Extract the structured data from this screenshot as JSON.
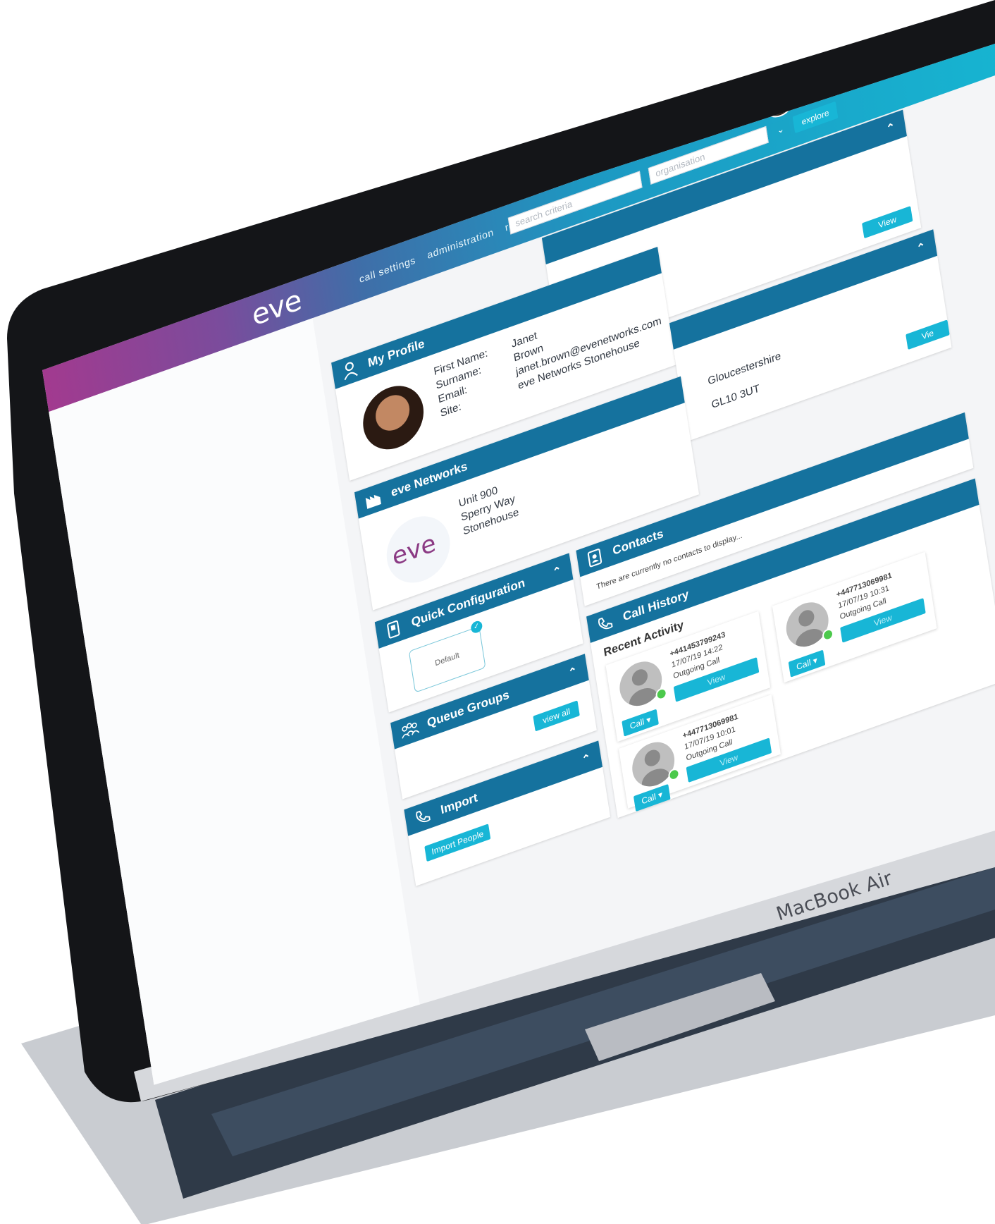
{
  "app": {
    "logo": "eve",
    "nav": [
      "call settings",
      "administration",
      "reporting"
    ],
    "search_placeholder": "search criteria",
    "org_placeholder": "organisation",
    "explore_label": "explore"
  },
  "top_panel": {
    "view_label": "View"
  },
  "profile": {
    "title": "My Profile",
    "fields": [
      {
        "label": "First Name:",
        "value": "Janet"
      },
      {
        "label": "Surname:",
        "value": "Brown"
      },
      {
        "label": "Email:",
        "value": "janet.brown@evenetworks.com"
      },
      {
        "label": "Site:",
        "value": "eve Networks Stonehouse"
      }
    ]
  },
  "right_panel": {
    "county": "Gloucestershire",
    "postcode": "GL10 3UT",
    "view_label": "Vie"
  },
  "site": {
    "title": "eve Networks",
    "address": [
      "Unit 900",
      "Sperry Way",
      "Stonehouse"
    ],
    "logo": "eve"
  },
  "quick_config": {
    "title": "Quick Configuration",
    "default_label": "Default"
  },
  "queue_groups": {
    "title": "Queue Groups",
    "view_all_label": "view all"
  },
  "import": {
    "title": "Import",
    "button_label": "Import People"
  },
  "contacts": {
    "title": "Contacts",
    "empty_text": "There are currently no contacts to display..."
  },
  "call_history": {
    "title": "Call History",
    "subtitle": "Recent Activity",
    "calls": [
      {
        "number": "+441453799243",
        "time": "17/07/19 14:22",
        "type": "Outgoing Call",
        "view": "View",
        "call": "Call ▾"
      },
      {
        "number": "+447713069981",
        "time": "17/07/19 10:01",
        "type": "Outgoing Call",
        "view": "View",
        "call": "Call ▾"
      },
      {
        "number": "+447713069981",
        "time": "17/07/19 10:31",
        "type": "Outgoing Call",
        "view": "View",
        "call": "Call ▾"
      }
    ]
  },
  "device": {
    "brand": "MacBook Air"
  }
}
